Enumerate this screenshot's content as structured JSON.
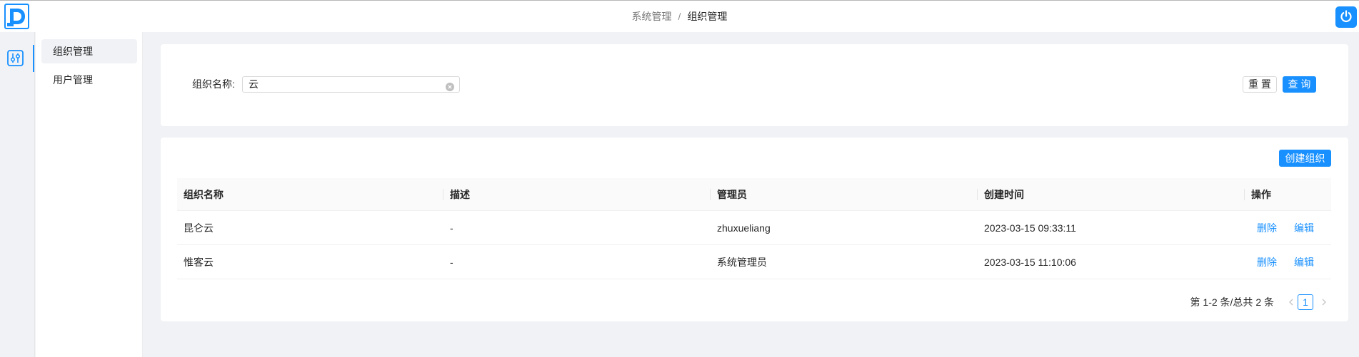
{
  "header": {
    "breadcrumb": {
      "parent": "系统管理",
      "separator": "/",
      "current": "组织管理"
    }
  },
  "icons": {
    "logo": "logo-icon",
    "power": "power-icon",
    "rail": "sliders-icon",
    "clear": "clear-icon",
    "prev": "chevron-left-icon",
    "next": "chevron-right-icon"
  },
  "sidebar": {
    "items": [
      {
        "label": "组织管理",
        "active": true
      },
      {
        "label": "用户管理",
        "active": false
      }
    ]
  },
  "search": {
    "label": "组织名称:",
    "value": "云",
    "reset_label": "重 置",
    "query_label": "查 询"
  },
  "table": {
    "create_label": "创建组织",
    "columns": [
      "组织名称",
      "描述",
      "管理员",
      "创建时间",
      "操作"
    ],
    "rows": [
      {
        "name": "昆仑云",
        "desc": "-",
        "admin": "zhuxueliang",
        "created": "2023-03-15 09:33:11"
      },
      {
        "name": "惟客云",
        "desc": "-",
        "admin": "系统管理员",
        "created": "2023-03-15 11:10:06"
      }
    ],
    "actions": {
      "delete": "删除",
      "edit": "编辑"
    }
  },
  "pagination": {
    "summary": "第 1-2 条/总共 2 条",
    "current": "1"
  },
  "colors": {
    "primary": "#1890ff",
    "background": "#f0f2f5",
    "card": "#ffffff",
    "table_header": "#fafafa"
  }
}
